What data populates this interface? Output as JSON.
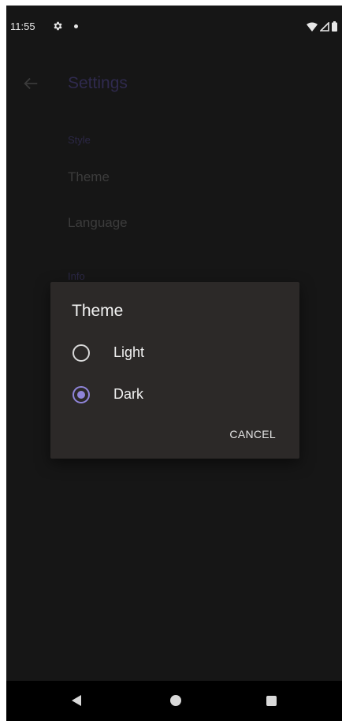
{
  "status_bar": {
    "time": "11:55",
    "icons": [
      "settings-gear-icon",
      "notification-dot-icon",
      "wifi-icon",
      "cellular-icon",
      "battery-icon"
    ]
  },
  "app_bar": {
    "title": "Settings",
    "back_icon": "arrow-back-icon"
  },
  "preferences": {
    "style_header": "Style",
    "theme_label": "Theme",
    "language_label": "Language",
    "info_header": "Info"
  },
  "dialog": {
    "title": "Theme",
    "options": [
      {
        "label": "Light",
        "selected": false
      },
      {
        "label": "Dark",
        "selected": true
      }
    ],
    "cancel_label": "CANCEL"
  },
  "colors": {
    "background": "#161616",
    "dialog_background": "#2c2928",
    "accent": "#8f84d8"
  },
  "nav_bar": {
    "icons": [
      "nav-back-icon",
      "nav-home-icon",
      "nav-recents-icon"
    ]
  }
}
